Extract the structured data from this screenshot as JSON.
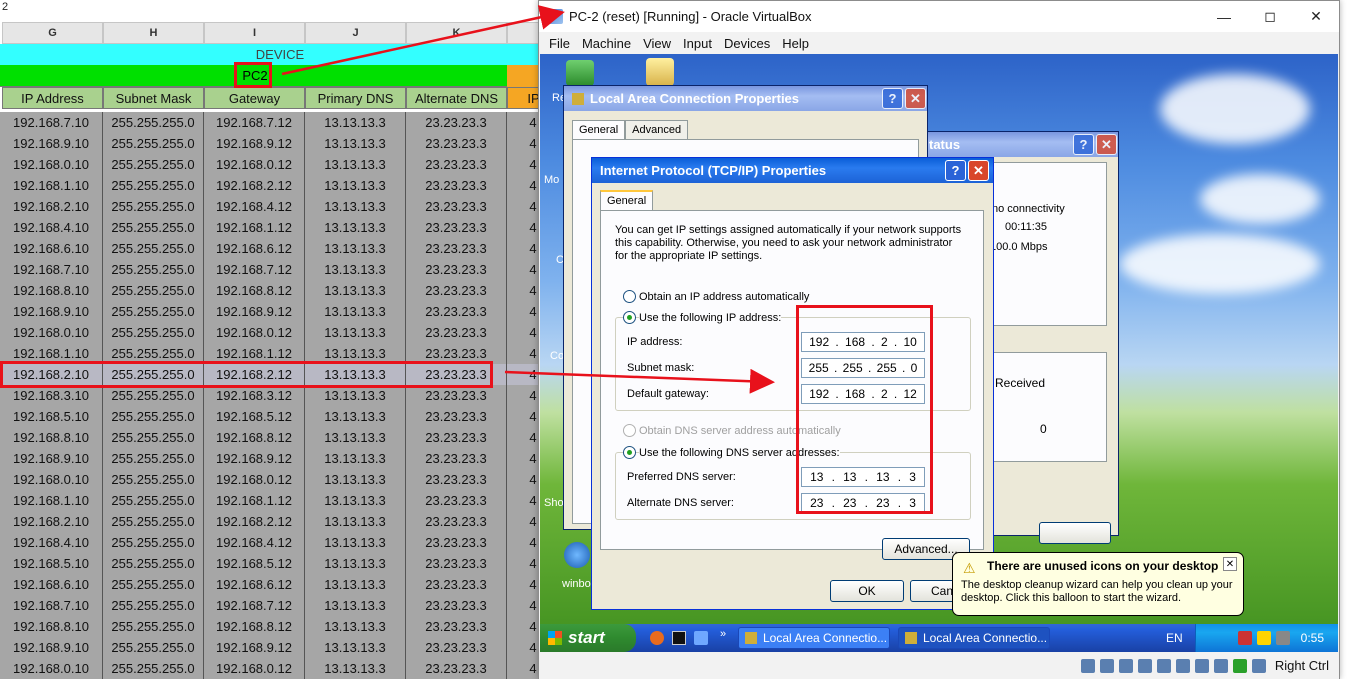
{
  "sheet": {
    "cell_ref": "2",
    "columns": [
      "G",
      "H",
      "I",
      "J",
      "K"
    ],
    "device_label": "DEVICE",
    "pc_label": "PC2",
    "field_headers": [
      "IP Address",
      "Subnet Mask",
      "Gateway",
      "Primary DNS",
      "Alternate DNS",
      "IP"
    ],
    "rows": [
      [
        "192.168.7.10",
        "255.255.255.0",
        "192.168.7.12",
        "13.13.13.3",
        "23.23.23.3",
        "4"
      ],
      [
        "192.168.9.10",
        "255.255.255.0",
        "192.168.9.12",
        "13.13.13.3",
        "23.23.23.3",
        "4"
      ],
      [
        "192.168.0.10",
        "255.255.255.0",
        "192.168.0.12",
        "13.13.13.3",
        "23.23.23.3",
        "4"
      ],
      [
        "192.168.1.10",
        "255.255.255.0",
        "192.168.2.12",
        "13.13.13.3",
        "23.23.23.3",
        "4"
      ],
      [
        "192.168.2.10",
        "255.255.255.0",
        "192.168.4.12",
        "13.13.13.3",
        "23.23.23.3",
        "4"
      ],
      [
        "192.168.4.10",
        "255.255.255.0",
        "192.168.1.12",
        "13.13.13.3",
        "23.23.23.3",
        "4"
      ],
      [
        "192.168.6.10",
        "255.255.255.0",
        "192.168.6.12",
        "13.13.13.3",
        "23.23.23.3",
        "4"
      ],
      [
        "192.168.7.10",
        "255.255.255.0",
        "192.168.7.12",
        "13.13.13.3",
        "23.23.23.3",
        "4"
      ],
      [
        "192.168.8.10",
        "255.255.255.0",
        "192.168.8.12",
        "13.13.13.3",
        "23.23.23.3",
        "4"
      ],
      [
        "192.168.9.10",
        "255.255.255.0",
        "192.168.9.12",
        "13.13.13.3",
        "23.23.23.3",
        "4"
      ],
      [
        "192.168.0.10",
        "255.255.255.0",
        "192.168.0.12",
        "13.13.13.3",
        "23.23.23.3",
        "4"
      ],
      [
        "192.168.1.10",
        "255.255.255.0",
        "192.168.1.12",
        "13.13.13.3",
        "23.23.23.3",
        "4"
      ],
      [
        "192.168.2.10",
        "255.255.255.0",
        "192.168.2.12",
        "13.13.13.3",
        "23.23.23.3",
        "4"
      ],
      [
        "192.168.3.10",
        "255.255.255.0",
        "192.168.3.12",
        "13.13.13.3",
        "23.23.23.3",
        "4"
      ],
      [
        "192.168.5.10",
        "255.255.255.0",
        "192.168.5.12",
        "13.13.13.3",
        "23.23.23.3",
        "4"
      ],
      [
        "192.168.8.10",
        "255.255.255.0",
        "192.168.8.12",
        "13.13.13.3",
        "23.23.23.3",
        "4"
      ],
      [
        "192.168.9.10",
        "255.255.255.0",
        "192.168.9.12",
        "13.13.13.3",
        "23.23.23.3",
        "4"
      ],
      [
        "192.168.0.10",
        "255.255.255.0",
        "192.168.0.12",
        "13.13.13.3",
        "23.23.23.3",
        "4"
      ],
      [
        "192.168.1.10",
        "255.255.255.0",
        "192.168.1.12",
        "13.13.13.3",
        "23.23.23.3",
        "4"
      ],
      [
        "192.168.2.10",
        "255.255.255.0",
        "192.168.2.12",
        "13.13.13.3",
        "23.23.23.3",
        "4"
      ],
      [
        "192.168.4.10",
        "255.255.255.0",
        "192.168.4.12",
        "13.13.13.3",
        "23.23.23.3",
        "4"
      ],
      [
        "192.168.5.10",
        "255.255.255.0",
        "192.168.5.12",
        "13.13.13.3",
        "23.23.23.3",
        "4"
      ],
      [
        "192.168.6.10",
        "255.255.255.0",
        "192.168.6.12",
        "13.13.13.3",
        "23.23.23.3",
        "4"
      ],
      [
        "192.168.7.10",
        "255.255.255.0",
        "192.168.7.12",
        "13.13.13.3",
        "23.23.23.3",
        "4"
      ],
      [
        "192.168.8.10",
        "255.255.255.0",
        "192.168.8.12",
        "13.13.13.3",
        "23.23.23.3",
        "4"
      ],
      [
        "192.168.9.10",
        "255.255.255.0",
        "192.168.9.12",
        "13.13.13.3",
        "23.23.23.3",
        "4"
      ],
      [
        "192.168.0.10",
        "255.255.255.0",
        "192.168.0.12",
        "13.13.13.3",
        "23.23.23.3",
        "4"
      ]
    ],
    "highlight_row": 12
  },
  "vbox": {
    "title": "PC-2 (reset) [Running] - Oracle VirtualBox",
    "menu": [
      "File",
      "Machine",
      "View",
      "Input",
      "Devices",
      "Help"
    ],
    "host_key": "Right Ctrl"
  },
  "lan_props": {
    "title": "Local Area Connection Properties",
    "tabs": [
      "General",
      "Advanced"
    ]
  },
  "status_win": {
    "title_fragment": "tatus",
    "conn": "d or no connectivity",
    "duration": "00:11:35",
    "speed": "100.0 Mbps",
    "received_label": "Received",
    "received_value": "0"
  },
  "tcpip": {
    "title": "Internet Protocol (TCP/IP) Properties",
    "tab": "General",
    "intro": "You can get IP settings assigned automatically if your network supports this capability. Otherwise, you need to ask your network administrator for the appropriate IP settings.",
    "obtain_ip": "Obtain an IP address automatically",
    "use_ip": "Use the following IP address:",
    "ip_label": "IP address:",
    "mask_label": "Subnet mask:",
    "gw_label": "Default gateway:",
    "ip": [
      "192",
      "168",
      "2",
      "10"
    ],
    "mask": [
      "255",
      "255",
      "255",
      "0"
    ],
    "gw": [
      "192",
      "168",
      "2",
      "12"
    ],
    "obtain_dns": "Obtain DNS server address automatically",
    "use_dns": "Use the following DNS server addresses:",
    "pdns_label": "Preferred DNS server:",
    "adns_label": "Alternate DNS server:",
    "pdns": [
      "13",
      "13",
      "13",
      "3"
    ],
    "adns": [
      "23",
      "23",
      "23",
      "3"
    ],
    "advanced": "Advanced...",
    "ok": "OK",
    "cancel": "Canc"
  },
  "balloon": {
    "title": "There are unused icons on your desktop",
    "body": "The desktop cleanup wizard can help you clean up your desktop. Click this balloon to start the wizard."
  },
  "taskbar": {
    "start": "start",
    "tasks": [
      "Local Area Connectio...",
      "Local Area Connectio..."
    ],
    "lang": "EN",
    "clock": "0:55"
  },
  "desktop_labels": [
    "Re",
    "Mo",
    "C",
    "Co",
    "Sho",
    "winbo"
  ]
}
